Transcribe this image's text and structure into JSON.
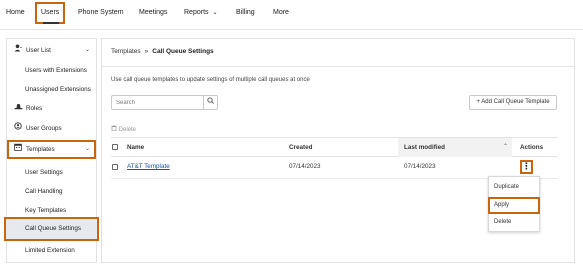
{
  "topnav": {
    "items": [
      {
        "label": "Home"
      },
      {
        "label": "Users"
      },
      {
        "label": "Phone System"
      },
      {
        "label": "Meetings"
      },
      {
        "label": "Reports"
      },
      {
        "label": "Billing"
      },
      {
        "label": "More"
      }
    ],
    "reports_caret": "⌄"
  },
  "sidebar": {
    "items": [
      {
        "label": "User List",
        "icon": "user-icon"
      },
      {
        "label": "Users with Extensions"
      },
      {
        "label": "Unassigned Extensions"
      },
      {
        "label": "Roles",
        "icon": "hat-icon"
      },
      {
        "label": "User Groups",
        "icon": "group-icon"
      },
      {
        "label": "Templates",
        "icon": "calendar-icon"
      },
      {
        "label": "User Settings"
      },
      {
        "label": "Call Handling"
      },
      {
        "label": "Key Templates"
      },
      {
        "label": "Call Queue Settings"
      },
      {
        "label": "Limited Extension"
      }
    ]
  },
  "main": {
    "breadcrumb": {
      "parent": "Templates",
      "separator": "»",
      "current": "Call Queue Settings"
    },
    "description": "Use call queue templates to update settings of multiple call queues at once",
    "search": {
      "placeholder": "Search"
    },
    "add_button": "+ Add Call Queue Template",
    "delete_label": "Delete",
    "table": {
      "headers": {
        "name": "Name",
        "created": "Created",
        "last_modified": "Last modified",
        "actions": "Actions"
      },
      "rows": [
        {
          "name": "AT&T Template",
          "created": "07/14/2023",
          "last_modified": "07/14/2023"
        }
      ]
    },
    "actions_menu": {
      "items": [
        "Duplicate",
        "Apply",
        "Delete"
      ]
    }
  },
  "colors": {
    "highlight": "#c8650f",
    "link": "#1a55a8",
    "selected_bg": "#e6eaee"
  }
}
